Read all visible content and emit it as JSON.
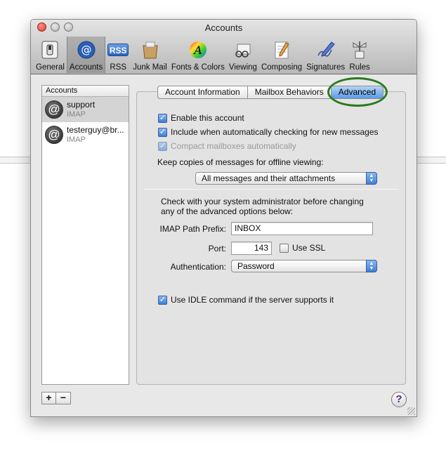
{
  "window": {
    "title": "Accounts"
  },
  "toolbar": {
    "items": [
      {
        "label": "General",
        "icon": "switch-icon"
      },
      {
        "label": "Accounts",
        "icon": "at-sign-icon",
        "selected": true
      },
      {
        "label": "RSS",
        "icon": "rss-icon"
      },
      {
        "label": "Junk Mail",
        "icon": "junk-mail-icon"
      },
      {
        "label": "Fonts & Colors",
        "icon": "fonts-colors-icon"
      },
      {
        "label": "Viewing",
        "icon": "viewing-icon"
      },
      {
        "label": "Composing",
        "icon": "composing-icon"
      },
      {
        "label": "Signatures",
        "icon": "signatures-icon"
      },
      {
        "label": "Rules",
        "icon": "rules-icon"
      }
    ],
    "rss_text": "RSS"
  },
  "sidebar": {
    "header": "Accounts",
    "accounts": [
      {
        "name": "support",
        "type": "IMAP",
        "selected": true
      },
      {
        "name": "testerguy@br...",
        "type": "IMAP",
        "selected": false
      }
    ],
    "add_label": "+",
    "remove_label": "−"
  },
  "tabs": [
    {
      "label": "Account Information",
      "active": false
    },
    {
      "label": "Mailbox Behaviors",
      "active": false
    },
    {
      "label": "Advanced",
      "active": true
    }
  ],
  "advanced": {
    "enable_account": {
      "label": "Enable this account",
      "checked": true
    },
    "include_check": {
      "label": "Include when automatically checking for new messages",
      "checked": true
    },
    "compact": {
      "label": "Compact mailboxes automatically",
      "checked": true,
      "disabled": true
    },
    "offline_label": "Keep copies of messages for offline viewing:",
    "offline_value": "All messages and their attachments",
    "admin_note_line1": "Check with your system administrator before changing",
    "admin_note_line2": "any of the advanced options below:",
    "imap_prefix_label": "IMAP Path Prefix:",
    "imap_prefix_value": "INBOX",
    "port_label": "Port:",
    "port_value": "143",
    "ssl": {
      "label": "Use SSL",
      "checked": false
    },
    "auth_label": "Authentication:",
    "auth_value": "Password",
    "idle": {
      "label": "Use IDLE command if the server supports it",
      "checked": true
    }
  },
  "help_label": "?",
  "colors": {
    "highlight_ring": "#2d7a1e",
    "accent_blue": "#3d7fd6"
  }
}
